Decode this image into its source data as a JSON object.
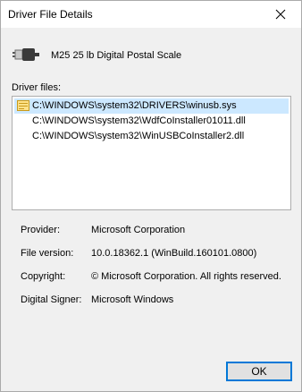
{
  "window": {
    "title": "Driver File Details"
  },
  "device": {
    "name": "M25 25 lb Digital Postal Scale",
    "icon": "usb-plug-icon"
  },
  "driver_files": {
    "label": "Driver files:",
    "items": [
      {
        "path": "C:\\WINDOWS\\system32\\DRIVERS\\winusb.sys",
        "selected": true
      },
      {
        "path": "C:\\WINDOWS\\system32\\WdfCoInstaller01011.dll",
        "selected": false
      },
      {
        "path": "C:\\WINDOWS\\system32\\WinUSBCoInstaller2.dll",
        "selected": false
      }
    ]
  },
  "properties": {
    "provider_label": "Provider:",
    "provider_value": "Microsoft Corporation",
    "file_version_label": "File version:",
    "file_version_value": "10.0.18362.1 (WinBuild.160101.0800)",
    "copyright_label": "Copyright:",
    "copyright_value": "© Microsoft Corporation. All rights reserved.",
    "signer_label": "Digital Signer:",
    "signer_value": "Microsoft Windows"
  },
  "buttons": {
    "ok_label": "OK"
  },
  "colors": {
    "selection": "#cce8ff",
    "accent": "#0078d7"
  }
}
